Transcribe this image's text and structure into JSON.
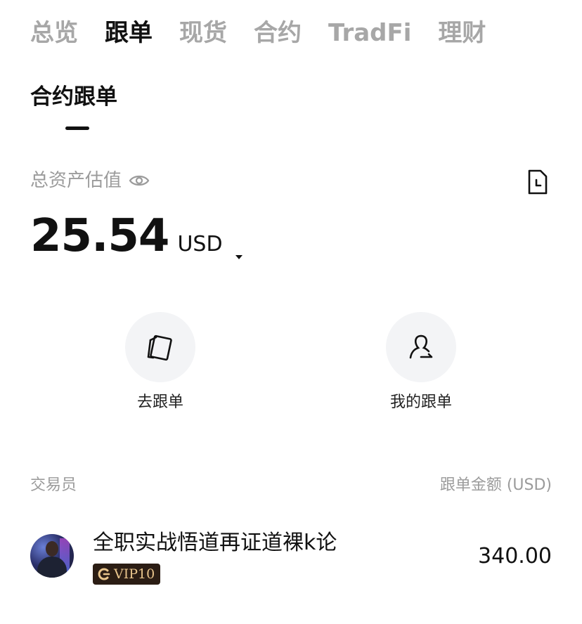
{
  "top_tabs": [
    {
      "label": "总览",
      "active": false
    },
    {
      "label": "跟单",
      "active": true
    },
    {
      "label": "现货",
      "active": false
    },
    {
      "label": "合约",
      "active": false
    },
    {
      "label": "TradFi",
      "active": false
    },
    {
      "label": "理财",
      "active": false
    }
  ],
  "sub_tab": {
    "label": "合约跟单"
  },
  "asset": {
    "label": "总资产估值",
    "value": "25.54",
    "currency": "USD"
  },
  "actions": {
    "go_copy": "去跟单",
    "my_copy": "我的跟单"
  },
  "list_header": {
    "trader": "交易员",
    "amount": "跟单金额 (USD)"
  },
  "traders": [
    {
      "name": "全职实战悟道再证道裸k论",
      "vip": "VIP10",
      "amount": "340.00"
    }
  ],
  "colors": {
    "active_text": "#111111",
    "inactive_text": "#a7a7a7",
    "vip_bg": "#2b1d14",
    "vip_gold": "#e9c58c"
  }
}
